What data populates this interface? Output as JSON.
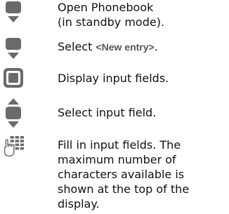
{
  "steps": [
    {
      "icon": "navigate-down-icon",
      "line1": "Open Phonebook",
      "line2": "(in standby mode)."
    },
    {
      "icon": "navigate-down-icon",
      "prefix": "Select ",
      "tag": "<New entry>",
      "suffix": "."
    },
    {
      "icon": "center-select-key-icon",
      "text": "Display input fields."
    },
    {
      "icon": "navigate-up-down-icon",
      "text": "Select input field."
    },
    {
      "icon": "keypad-hand-icon",
      "lines": [
        "Fill in input fields. The",
        "maximum number of",
        "characters available is",
        "shown at the top of the",
        "display."
      ]
    }
  ],
  "colors": {
    "icon_fill": "#6a6a6a",
    "text": "#111111",
    "tag": "#555555"
  }
}
